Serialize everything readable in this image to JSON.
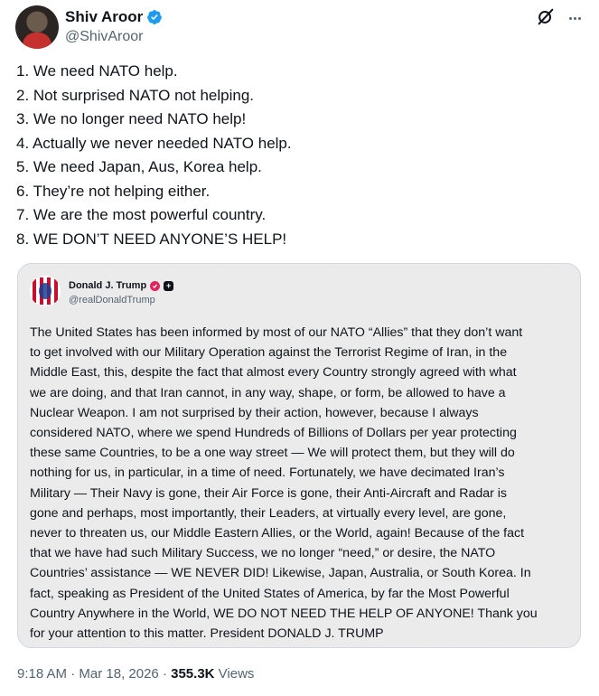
{
  "author": {
    "display_name": "Shiv Aroor",
    "handle": "@ShivAroor",
    "verified_color": "#1d9bf0"
  },
  "tweet_lines": [
    "1. We need NATO help.",
    "2. Not surprised NATO not helping.",
    "3. We no longer need NATO help!",
    "4. Actually we never needed NATO help.",
    "5. We need Japan, Aus, Korea help.",
    "6. They’re not helping either.",
    "7. We are the most powerful country.",
    "8. WE DON’T NEED ANYONE’S HELP!"
  ],
  "quote": {
    "display_name": "Donald J. Trump",
    "handle": "@realDonaldTrump",
    "badge_glyph": "+",
    "lines": [
      "The United States has been informed by most of our NATO “Allies” that they don’t want",
      "to get involved with our Military Operation against the Terrorist Regime of Iran, in the",
      "Middle East, this, despite the fact that almost every Country strongly agreed with what",
      "we are doing, and that Iran cannot, in any way, shape, or form, be allowed to have a",
      "Nuclear Weapon. I am not surprised by their action, however, because I always",
      "considered NATO, where we spend Hundreds of Billions of Dollars per year protecting",
      "these same Countries, to be a one way street — We will protect them, but they will do",
      "nothing for us, in particular, in a time of need. Fortunately, we have decimated Iran’s",
      "Military — Their Navy is gone, their Air Force is gone, their Anti-Aircraft and Radar is",
      "gone and perhaps, most importantly, their Leaders, at virtually every level, are gone,",
      "never to threaten us, our Middle Eastern Allies, or the World, again! Because of the fact",
      "that we have had such Military Success, we no longer “need,” or desire, the NATO",
      "Countries’ assistance — WE NEVER DID! Likewise, Japan, Australia, or South Korea. In",
      "fact, speaking as President of the United States of America, by far the Most Powerful",
      "Country Anywhere in the World, WE DO NOT NEED THE HELP OF ANYONE! Thank you",
      "for your attention to this matter. President DONALD J. TRUMP"
    ]
  },
  "meta": {
    "time": "9:18 AM",
    "separator": " · ",
    "date": "Mar 18, 2026",
    "views_count": "355.3K",
    "views_label": " Views"
  },
  "icons": {
    "header_actions": [
      "grok-icon",
      "more-icon"
    ]
  }
}
